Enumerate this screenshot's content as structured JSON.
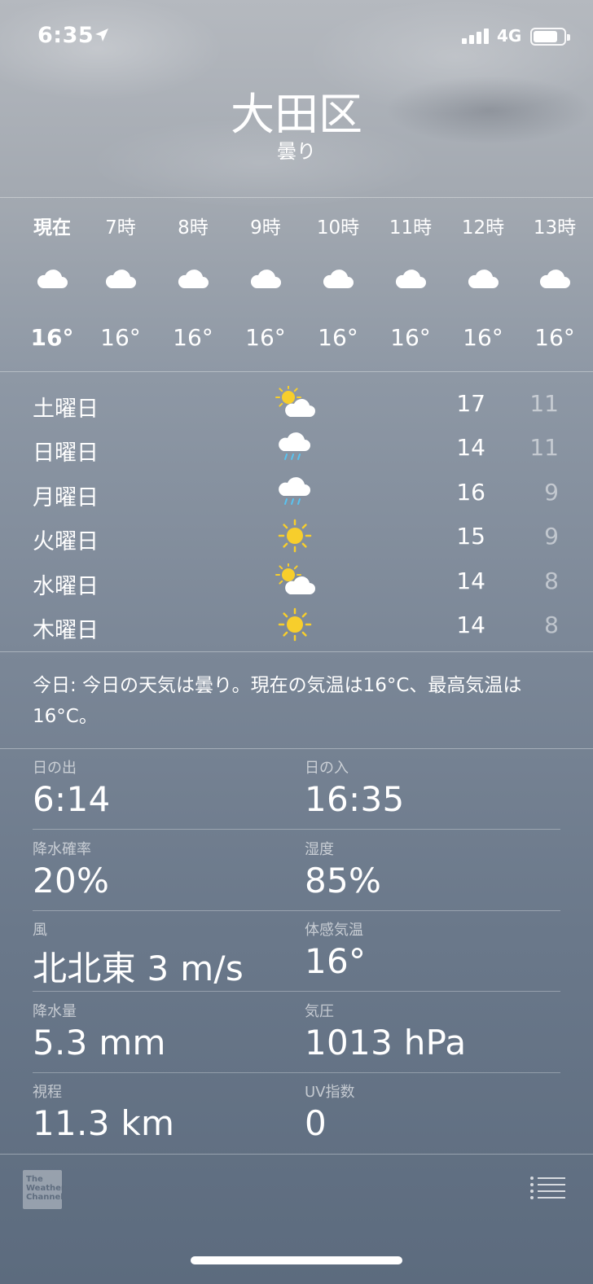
{
  "status_bar": {
    "time": "6:35",
    "network": "4G",
    "signal_bars": 4,
    "battery_level": 0.8
  },
  "location": {
    "city": "大田区",
    "condition": "曇り"
  },
  "hourly": [
    {
      "label": "現在",
      "icon": "cloud-icon",
      "temp": "16°"
    },
    {
      "label": "7時",
      "icon": "cloud-icon",
      "temp": "16°"
    },
    {
      "label": "8時",
      "icon": "cloud-icon",
      "temp": "16°"
    },
    {
      "label": "9時",
      "icon": "cloud-icon",
      "temp": "16°"
    },
    {
      "label": "10時",
      "icon": "cloud-icon",
      "temp": "16°"
    },
    {
      "label": "11時",
      "icon": "cloud-icon",
      "temp": "16°"
    },
    {
      "label": "12時",
      "icon": "cloud-icon",
      "temp": "16°"
    },
    {
      "label": "13時",
      "icon": "cloud-icon",
      "temp": "16°"
    }
  ],
  "daily": [
    {
      "day": "土曜日",
      "icon": "partly-cloudy-icon",
      "high": "17",
      "low": "11"
    },
    {
      "day": "日曜日",
      "icon": "rain-icon",
      "high": "14",
      "low": "11"
    },
    {
      "day": "月曜日",
      "icon": "rain-icon",
      "high": "16",
      "low": "9"
    },
    {
      "day": "火曜日",
      "icon": "sun-icon",
      "high": "15",
      "low": "9"
    },
    {
      "day": "水曜日",
      "icon": "partly-cloudy-icon",
      "high": "14",
      "low": "8"
    },
    {
      "day": "木曜日",
      "icon": "sun-icon",
      "high": "14",
      "low": "8"
    }
  ],
  "summary": "今日: 今日の天気は曇り。現在の気温は16°C、最高気温は16°C。",
  "details": [
    {
      "left": {
        "label": "日の出",
        "value": "6:14"
      },
      "right": {
        "label": "日の入",
        "value": "16:35"
      }
    },
    {
      "left": {
        "label": "降水確率",
        "value": "20%"
      },
      "right": {
        "label": "湿度",
        "value": "85%"
      }
    },
    {
      "left": {
        "label": "風",
        "value": "北北東 3 m/s"
      },
      "right": {
        "label": "体感気温",
        "value": "16°"
      }
    },
    {
      "left": {
        "label": "降水量",
        "value": "5.3 mm"
      },
      "right": {
        "label": "気圧",
        "value": "1013 hPa"
      }
    },
    {
      "left": {
        "label": "視程",
        "value": "11.3 km"
      },
      "right": {
        "label": "UV指数",
        "value": "0"
      }
    }
  ],
  "footer": {
    "brand_logo_text": [
      "The",
      "Weather",
      "Channel"
    ]
  },
  "colors": {
    "sun": "#f7ce2c",
    "rain": "#59c3f0"
  }
}
